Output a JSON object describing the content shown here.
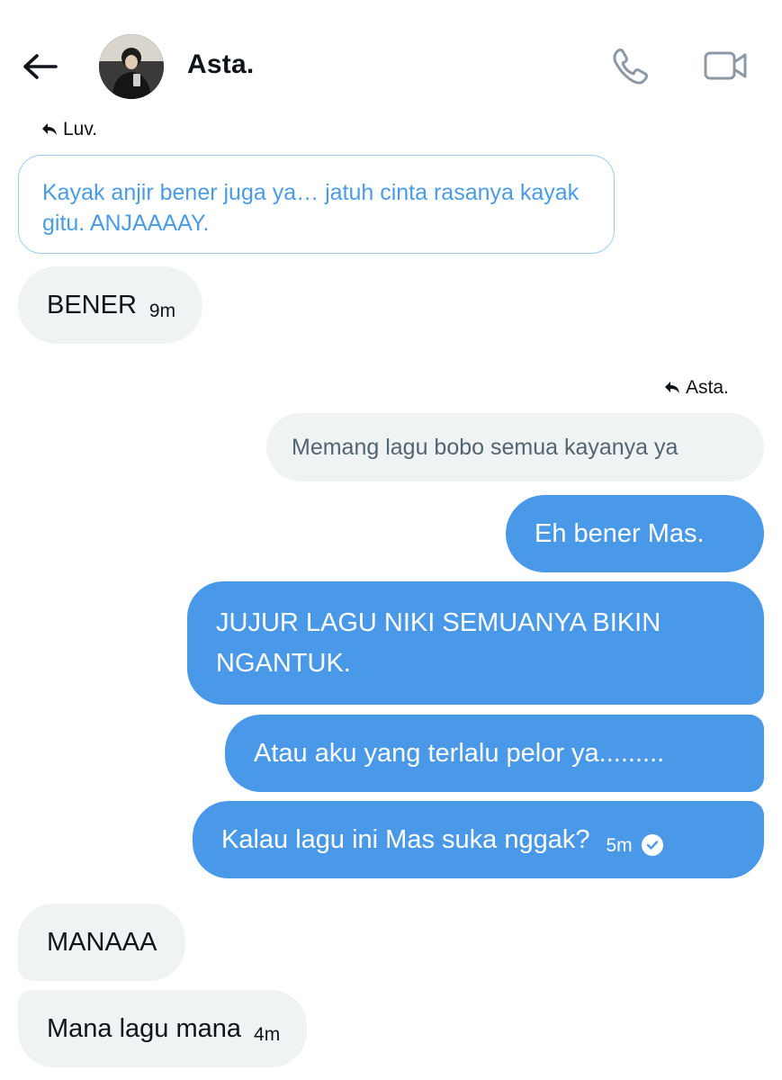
{
  "header": {
    "contact_name": "Asta.",
    "back_icon": "arrow-left-icon",
    "call_icon": "phone-icon",
    "video_icon": "video-camera-icon"
  },
  "messages": {
    "m1": {
      "reply_to": "Luv.",
      "quoted_text": "Kayak anjir bener juga ya… jatuh cinta rasanya kayak gitu. ANJAAAAY.",
      "text": "BENER",
      "time": "9m"
    },
    "m2": {
      "reply_to": "Asta.",
      "quoted_text": "Memang lagu bobo semua kayanya ya"
    },
    "m3": {
      "text": "Eh bener Mas."
    },
    "m4": {
      "text": "JUJUR LAGU NIKI SEMUANYA BIKIN NGANTUK."
    },
    "m5": {
      "text": "Atau aku yang terlalu pelor ya........."
    },
    "m6": {
      "text": "Kalau lagu ini Mas suka nggak?",
      "time": "5m",
      "status_icon": "check-circle-icon"
    },
    "m7": {
      "text": "MANAAA"
    },
    "m8": {
      "text": "Mana lagu mana",
      "time": "4m"
    }
  },
  "colors": {
    "outgoing_bubble": "#4a99e9",
    "incoming_bubble": "#eff3f4",
    "quoted_border": "#9ecbf2",
    "quoted_text": "#4a9be6"
  }
}
